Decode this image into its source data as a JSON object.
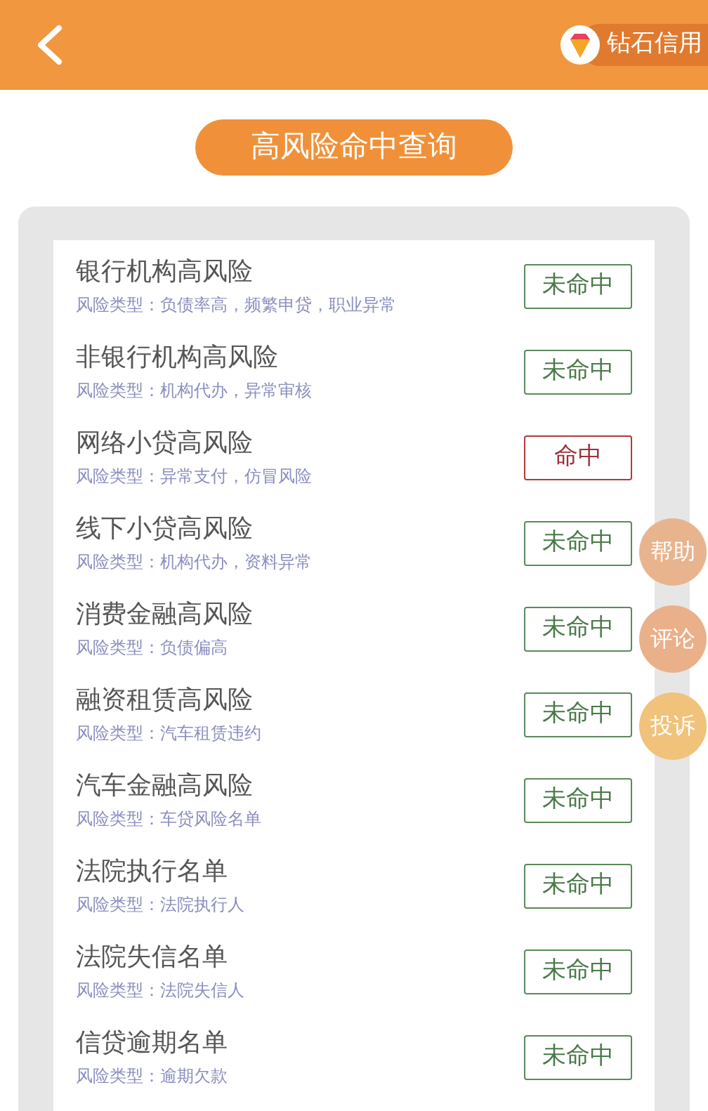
{
  "header": {
    "brand": "钻石信用"
  },
  "title": "高风险命中查询",
  "items": [
    {
      "name": "银行机构高风险",
      "type": "风险类型：负债率高，频繁申贷，职业异常",
      "status": "未命中",
      "hit": false
    },
    {
      "name": "非银行机构高风险",
      "type": "风险类型：机构代办，异常审核",
      "status": "未命中",
      "hit": false
    },
    {
      "name": "网络小贷高风险",
      "type": "风险类型：异常支付，仿冒风险",
      "status": "命中",
      "hit": true
    },
    {
      "name": "线下小贷高风险",
      "type": "风险类型：机构代办，资料异常",
      "status": "未命中",
      "hit": false
    },
    {
      "name": "消费金融高风险",
      "type": "风险类型：负债偏高",
      "status": "未命中",
      "hit": false
    },
    {
      "name": "融资租赁高风险",
      "type": "风险类型：汽车租赁违约",
      "status": "未命中",
      "hit": false
    },
    {
      "name": "汽车金融高风险",
      "type": "风险类型：车贷风险名单",
      "status": "未命中",
      "hit": false
    },
    {
      "name": "法院执行名单",
      "type": "风险类型：法院执行人",
      "status": "未命中",
      "hit": false
    },
    {
      "name": "法院失信名单",
      "type": "风险类型：法院失信人",
      "status": "未命中",
      "hit": false
    },
    {
      "name": "信贷逾期名单",
      "type": "风险类型：逾期欠款",
      "status": "未命中",
      "hit": false
    }
  ],
  "float_buttons": [
    {
      "label": "帮助",
      "color": "#e8b48e"
    },
    {
      "label": "评论",
      "color": "#eab08a"
    },
    {
      "label": "投诉",
      "color": "#f0c27a"
    }
  ]
}
